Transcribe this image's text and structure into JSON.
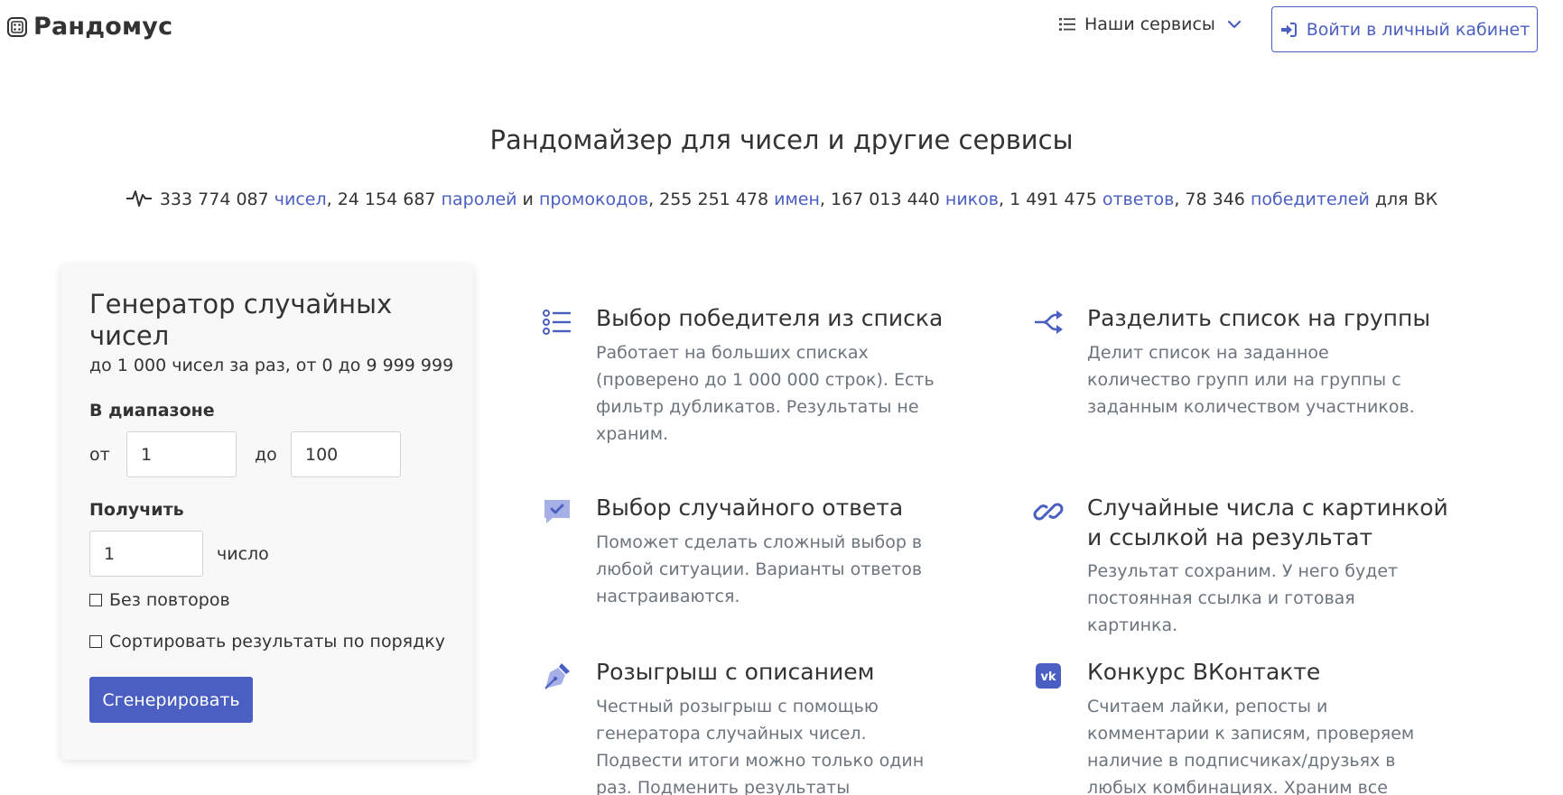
{
  "header": {
    "logo_text": "Рандомус",
    "services_label": "Наши сервисы",
    "login_label": "Войти в личный кабинет"
  },
  "page_title": "Рандомайзер для чисел и другие сервисы",
  "stats": {
    "numbers_count": "333 774 087",
    "numbers_label": "чисел",
    "passwords_count": "24 154 687",
    "passwords_label": "паролей",
    "and_word": "и",
    "promocodes_label": "промокодов",
    "names_count": "255 251 478",
    "names_label": "имен",
    "nicks_count": "167 013 440",
    "nicks_label": "ников",
    "answers_count": "1 491 475",
    "answers_label": "ответов",
    "winners_count": "78 346",
    "winners_label": "победителей",
    "vk_suffix": "для ВК"
  },
  "generator": {
    "title": "Генератор случайных чисел",
    "subtitle": "до 1 000 чисел за раз, от 0 до 9 999 999",
    "range_label": "В диапазоне",
    "from_label": "от",
    "from_value": "1",
    "to_label": "до",
    "to_value": "100",
    "get_label": "Получить",
    "count_value": "1",
    "count_unit": "число",
    "no_repeat_label": "Без повторов",
    "sort_label": "Сортировать результаты по порядку",
    "generate_button": "Сгенерировать"
  },
  "features": [
    {
      "icon": "list-numbered-icon",
      "title": "Выбор победителя из списка",
      "description": "Работает на больших списках (проверено до 1 000 000 строк). Есть фильтр дубликатов. Результаты не храним."
    },
    {
      "icon": "split-arrows-icon",
      "title": "Разделить список на группы",
      "description": "Делит список на заданное количество групп или на группы с заданным количеством участников."
    },
    {
      "icon": "chat-check-icon",
      "title": "Выбор случайного ответа",
      "description": "Поможет сделать сложный выбор в любой ситуации. Варианты ответов настраиваются."
    },
    {
      "icon": "link-icon",
      "title": "Случайные числа с картинкой и ссылкой на результат",
      "description": "Результат сохраним. У него будет постоянная ссылка и готовая картинка."
    },
    {
      "icon": "pen-nib-icon",
      "title": "Розыгрыш с описанием",
      "description": "Честный розыгрыш с помощью генератора случайных чисел. Подвести итоги можно только один раз. Подменить результаты невозможно."
    },
    {
      "icon": "vk-icon",
      "title": "Конкурс ВКонтакте",
      "description": "Считаем лайки, репосты и комментарии к записям, проверяем наличие в подписчиках/друзьях в любых комбинациях. Храним все результаты."
    }
  ],
  "colors": {
    "accent": "#4a5fc1",
    "muted_text": "#6c757d",
    "icon_color": "#4a5fc1"
  }
}
